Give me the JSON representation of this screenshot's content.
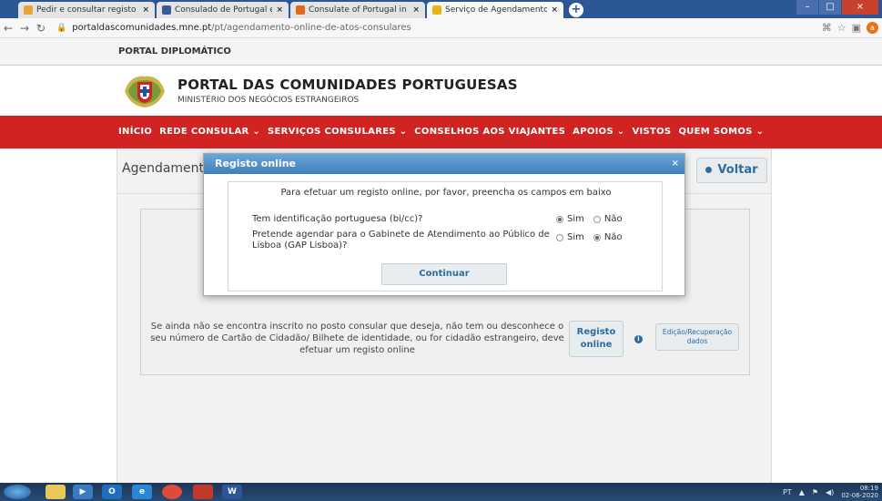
{
  "browser": {
    "tabs": [
      {
        "label": "Pedir e consultar registo crimina",
        "color": "#e8a33a"
      },
      {
        "label": "Consulado de Portugal em New",
        "color": "#3b5998"
      },
      {
        "label": "Consulate of Portugal in New Be",
        "color": "#e06a1c"
      },
      {
        "label": "Serviço de Agendamento Online",
        "color": "#e8b21a"
      }
    ],
    "new_tab_label": "+",
    "url_domain": "portaldascomunidades.mne.pt",
    "url_path": "/pt/agendamento-online-de-atos-consulares",
    "profile_initial": "a"
  },
  "site": {
    "top_strip": "PORTAL DIPLOMÁTICO",
    "title": "PORTAL DAS COMUNIDADES PORTUGUESAS",
    "subtitle": "MINISTÉRIO DOS NEGÓCIOS ESTRANGEIROS",
    "nav": [
      "INÍCIO",
      "REDE CONSULAR ⌄",
      "SERVIÇOS CONSULARES ⌄",
      "CONSELHOS AOS VIAJANTES",
      "APOIOS ⌄",
      "VISTOS",
      "QUEM SOMOS ⌄"
    ]
  },
  "content": {
    "heading": "Agendamentos",
    "voltar": "Voltar",
    "info_text": "Se ainda não se encontra inscrito no posto consular que deseja, não tem ou desconhece o seu número de Cartão de Cidadão/ Bilhete de identidade, ou for cidadão estrangeiro, deve efetuar um registo online",
    "registo_line1": "Registo",
    "registo_line2": "online",
    "edicao_line1": "Edição/Recuperação",
    "edicao_line2": "dados"
  },
  "modal": {
    "title": "Registo online",
    "close": "×",
    "intro": "Para efetuar um registo online, por favor, preencha os campos em baixo",
    "q1": "Tem identificação portuguesa (bi/cc)?",
    "q2": "Pretende agendar para o Gabinete de Atendimento ao Público de Lisboa (GAP Lisboa)?",
    "yes": "Sim",
    "no": "Não",
    "q1_selected": "Sim",
    "q2_selected": "Não",
    "continuar": "Continuar"
  },
  "taskbar": {
    "lang": "PT",
    "time": "08:19",
    "date": "02-06-2020"
  }
}
